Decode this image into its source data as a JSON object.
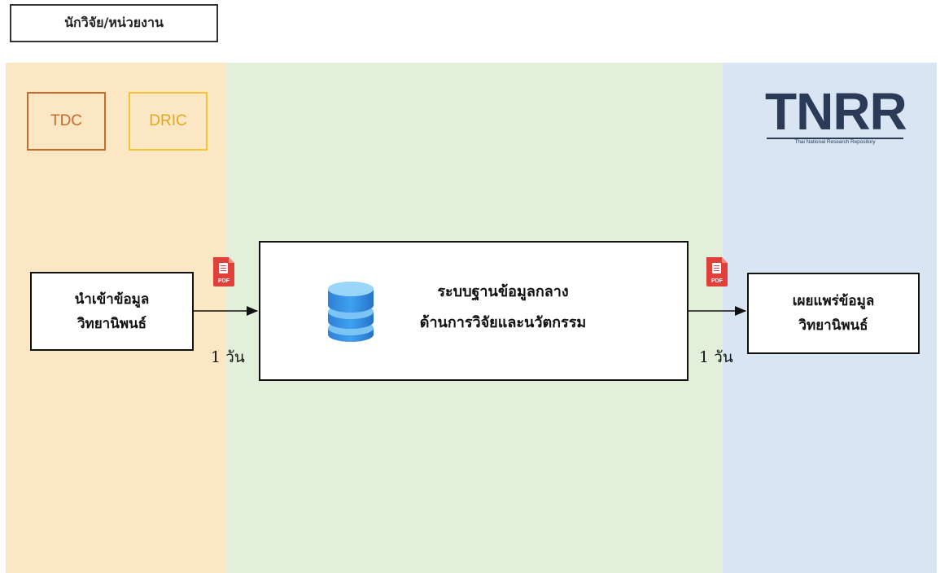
{
  "header": {
    "role_label": "นักวิจัย/หน่วยงาน"
  },
  "orgs": {
    "tdc": "TDC",
    "dric": "DRIC"
  },
  "logo": {
    "name": "TNRR",
    "tagline": "Thai National Research Repository"
  },
  "steps": {
    "import": {
      "line1": "นำเข้าข้อมูล",
      "line2": "วิทยานิพนธ์"
    },
    "central": {
      "line1": "ระบบฐานข้อมูลกลาง",
      "line2": "ด้านการวิจัยและนวัตกรรม"
    },
    "publish": {
      "line1": "เผยแพร่ข้อมูล",
      "line2": "วิทยานิพนธ์"
    }
  },
  "durations": {
    "first": "1 วัน",
    "second": "1 วัน"
  },
  "icons": {
    "pdf": "pdf-file-icon",
    "db": "database-icon"
  },
  "colors": {
    "lane_yellow": "#fbe7c3",
    "lane_green": "#e2efda",
    "lane_blue": "#dae5f3",
    "tdc": "#c86a2c",
    "dric": "#f5c338",
    "pdf_red": "#e0403a",
    "db_blue": "#2d8be0"
  }
}
